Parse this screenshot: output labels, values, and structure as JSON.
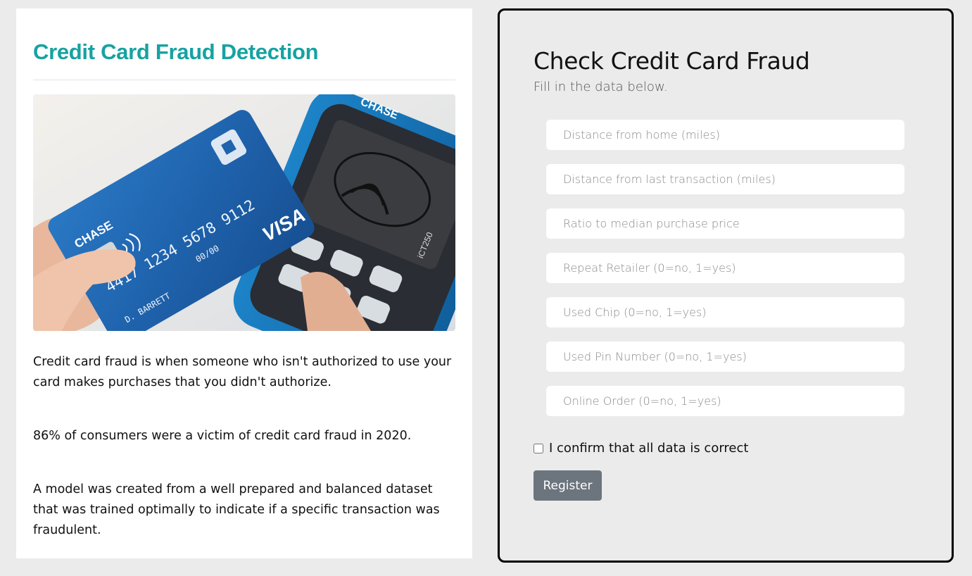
{
  "brand_color": "#17a2a2",
  "left": {
    "title": "Credit Card Fraud Detection",
    "image": {
      "card_brand": "CHASE",
      "card_number": "4417 1234 5678 9112",
      "card_expiry": "00/00",
      "card_holder": "D. BARRETT",
      "card_network": "VISA",
      "terminal_model": "iCT250"
    },
    "paragraphs": [
      "Credit card fraud is when someone who isn't authorized to use your card makes purchases that you didn't authorize.",
      "86% of consumers were a victim of credit card fraud in 2020.",
      "A model was created from a well prepared and balanced dataset that was trained optimally to indicate if a specific transaction was fraudulent."
    ]
  },
  "form": {
    "title": "Check Credit Card Fraud",
    "subtitle": "Fill in the data below.",
    "fields": [
      {
        "placeholder": "Distance from home (miles)",
        "value": ""
      },
      {
        "placeholder": "Distance from last transaction (miles)",
        "value": ""
      },
      {
        "placeholder": "Ratio to median purchase price",
        "value": ""
      },
      {
        "placeholder": "Repeat Retailer (0=no, 1=yes)",
        "value": ""
      },
      {
        "placeholder": "Used Chip (0=no, 1=yes)",
        "value": ""
      },
      {
        "placeholder": "Used Pin Number (0=no, 1=yes)",
        "value": ""
      },
      {
        "placeholder": "Online Order (0=no, 1=yes)",
        "value": ""
      }
    ],
    "confirm_label": "I confirm that all data is correct",
    "confirm_checked": false,
    "submit_label": "Register"
  }
}
